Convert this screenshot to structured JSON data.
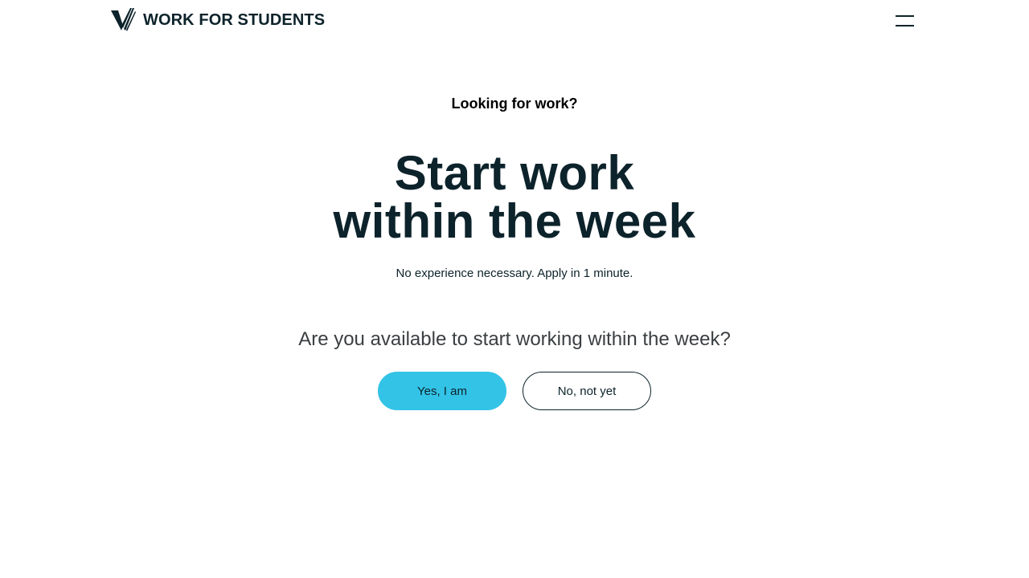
{
  "header": {
    "brand_name": "WORK FOR STUDENTS",
    "logo_icon": "wfs-logo-icon",
    "menu_icon": "hamburger-menu-icon"
  },
  "hero": {
    "eyebrow": "Looking for work?",
    "headline_line1": "Start work",
    "headline_line2": "within the week",
    "subtext": "No experience necessary. Apply in 1 minute."
  },
  "question": {
    "text": "Are you available to start working within the week?",
    "options": [
      {
        "label": "Yes, I am",
        "style": "primary"
      },
      {
        "label": "No, not yet",
        "style": "secondary"
      }
    ]
  },
  "colors": {
    "text_dark": "#0d232b",
    "accent": "#33c3e6",
    "question_text": "#3a3f42",
    "background": "#ffffff"
  }
}
